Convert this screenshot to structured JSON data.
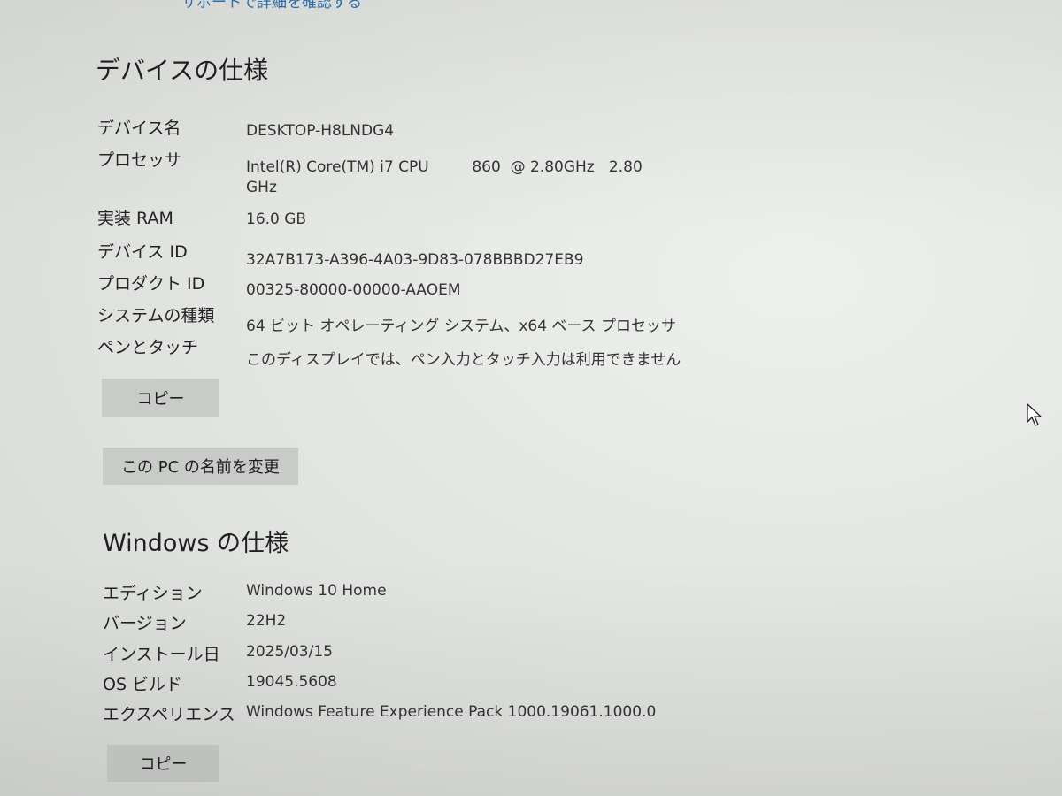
{
  "top_link": "サポートで詳細を確認する",
  "device_specs": {
    "title": "デバイスの仕様",
    "rows": [
      {
        "label": "デバイス名",
        "value": "DESKTOP-H8LNDG4"
      },
      {
        "label": "プロセッサ",
        "value": "Intel(R) Core(TM) i7 CPU         860  @ 2.80GHz   2.80 GHz"
      },
      {
        "label": "実装 RAM",
        "value": "16.0 GB"
      },
      {
        "label": "デバイス ID",
        "value": "32A7B173-A396-4A03-9D83-078BBBD27EB9"
      },
      {
        "label": "プロダクト ID",
        "value": "00325-80000-00000-AAOEM"
      },
      {
        "label": "システムの種類",
        "value": "64 ビット オペレーティング システム、x64 ベース プロセッサ"
      },
      {
        "label": "ペンとタッチ",
        "value": "このディスプレイでは、ペン入力とタッチ入力は利用できません"
      }
    ],
    "copy_label": "コピー",
    "rename_label": "この PC の名前を変更"
  },
  "windows_specs": {
    "title": "Windows の仕様",
    "rows": [
      {
        "label": "エディション",
        "value": "Windows 10 Home"
      },
      {
        "label": "バージョン",
        "value": "22H2"
      },
      {
        "label": "インストール日",
        "value": "2025/03/15"
      },
      {
        "label": "OS ビルド",
        "value": "19045.5608"
      },
      {
        "label": "エクスペリエンス",
        "value": "Windows Feature Experience Pack 1000.19061.1000.0"
      }
    ],
    "copy_label": "コピー"
  },
  "icons": {
    "cursor": "mouse-pointer-icon"
  }
}
